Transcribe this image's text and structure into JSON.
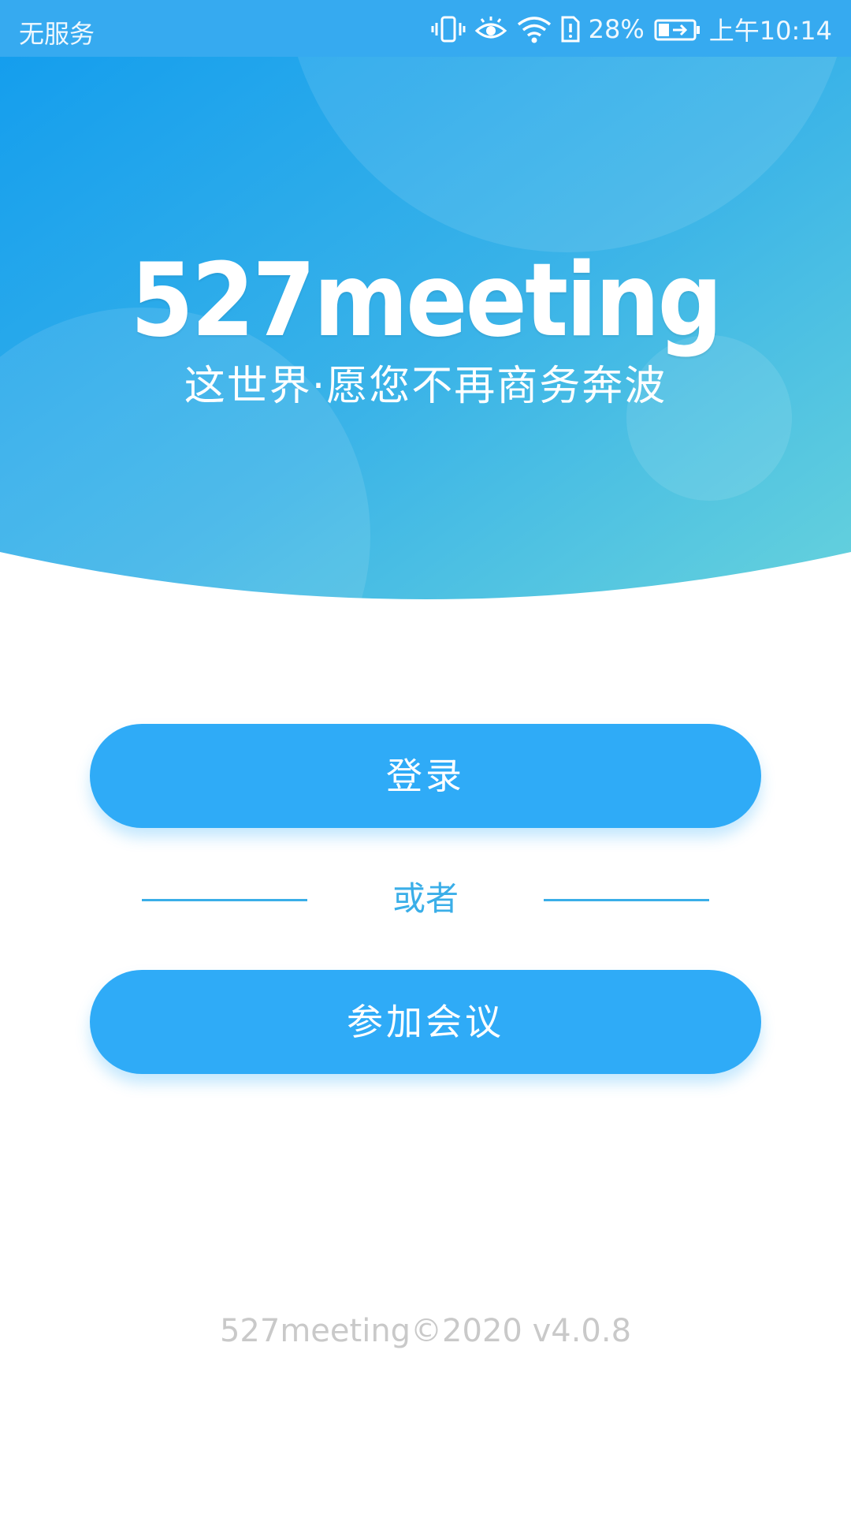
{
  "status_bar": {
    "carrier": "无服务",
    "battery_percent": "28%",
    "time": "上午10:14",
    "icons": [
      "vibrate-icon",
      "eye-comfort-icon",
      "wifi-icon",
      "sim-alert-icon",
      "battery-charging-icon"
    ]
  },
  "hero": {
    "brand": "527meeting",
    "slogan": "这世界·愿您不再商务奔波"
  },
  "actions": {
    "login_label": "登录",
    "divider_label": "或者",
    "join_label": "参加会议"
  },
  "footer": {
    "version": "527meeting©2020 v4.0.8"
  },
  "colors": {
    "status_bar": "#36aaf0",
    "hero_start": "#1fa0ee",
    "hero_end": "#62d0dc",
    "button": "#2fabf7",
    "divider": "#3aaee8",
    "footer_text": "#c9c9c9"
  }
}
